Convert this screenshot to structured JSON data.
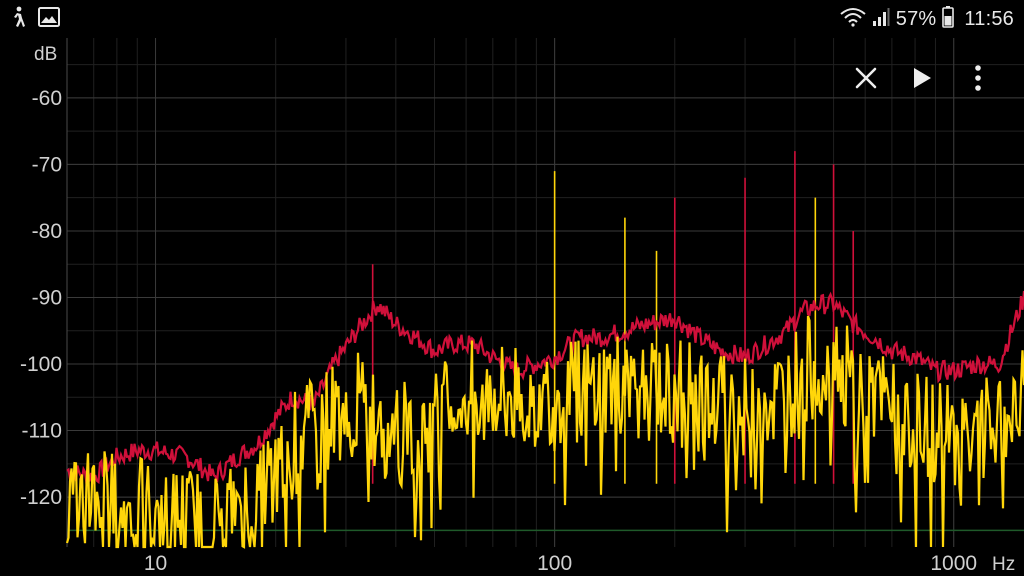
{
  "status_bar": {
    "left_icons": [
      "walking-icon",
      "image-icon"
    ],
    "right_icons": [
      "wifi-icon",
      "signal-icon",
      "battery-icon"
    ],
    "battery": "57%",
    "time": "11:56"
  },
  "toolbar": {
    "buttons": [
      {
        "icon": "close-icon"
      },
      {
        "icon": "play-icon"
      },
      {
        "icon": "more-vert-icon"
      }
    ]
  },
  "colors": {
    "background": "#000000",
    "grid_major": "#3a3a3a",
    "grid_minor": "#202020",
    "peak_trace": "#d0103a",
    "live_trace": "#ffd60a",
    "noise_floor_line": "#1f5a2a"
  },
  "chart_data": {
    "type": "line",
    "scale_x": "log",
    "ylabel": "dB",
    "xlim": [
      6,
      1500
    ],
    "ylim": [
      -127.5,
      -51
    ],
    "y_ticks": [
      -60,
      -70,
      -80,
      -90,
      -100,
      -110,
      -120
    ],
    "y_tick_labels": [
      "-60",
      "-70",
      "-80",
      "-90",
      "-100",
      "-110",
      "-120"
    ],
    "x_ticks": [
      10,
      100,
      1000
    ],
    "x_tick_labels": [
      "10",
      "100",
      "1000"
    ],
    "x_unit_label": "Hz",
    "grid": true,
    "noise_floor_db": -125,
    "series": [
      {
        "role": "peak-hold",
        "color": "#d0103a",
        "x": [
          6,
          7,
          8,
          9,
          10,
          12,
          14,
          16,
          18,
          20,
          22,
          25,
          28,
          32,
          36,
          40,
          45,
          50,
          56,
          63,
          70,
          80,
          90,
          100,
          115,
          130,
          150,
          170,
          200,
          230,
          260,
          300,
          340,
          380,
          420,
          460,
          500,
          560,
          630,
          700,
          800,
          900,
          1000,
          1150,
          1300,
          1500
        ],
        "y": [
          -116,
          -117,
          -114,
          -113,
          -113,
          -114,
          -117,
          -114,
          -112,
          -108,
          -105,
          -106,
          -100,
          -95,
          -91,
          -94,
          -96,
          -98,
          -97,
          -97,
          -99,
          -101,
          -100,
          -99,
          -96,
          -96,
          -95,
          -94,
          -93,
          -96,
          -98,
          -99,
          -97,
          -95,
          -92,
          -91,
          -91,
          -94,
          -96,
          -98,
          -99,
          -101,
          -101,
          -100,
          -100,
          -90
        ]
      },
      {
        "role": "live",
        "color": "#ffd60a",
        "x": [
          6,
          7,
          8,
          9,
          10,
          12,
          14,
          16,
          18,
          20,
          22,
          25,
          28,
          32,
          36,
          40,
          45,
          50,
          56,
          63,
          70,
          80,
          90,
          100,
          115,
          130,
          150,
          170,
          200,
          230,
          260,
          300,
          340,
          380,
          420,
          460,
          500,
          560,
          630,
          700,
          800,
          900,
          1000,
          1150,
          1300,
          1500
        ],
        "y": [
          -120,
          -119,
          -121,
          -122,
          -122,
          -123,
          -124,
          -121,
          -120,
          -116,
          -112,
          -110,
          -107,
          -106,
          -108,
          -110,
          -110,
          -109,
          -106,
          -104,
          -104,
          -105,
          -105,
          -104,
          -104,
          -103,
          -103,
          -104,
          -104,
          -105,
          -106,
          -107,
          -106,
          -104,
          -101,
          -100,
          -100,
          -103,
          -105,
          -107,
          -109,
          -110,
          -111,
          -110,
          -110,
          -104
        ]
      }
    ],
    "spikes": [
      {
        "x": 100,
        "y": -71,
        "color": "#ffd60a"
      },
      {
        "x": 150,
        "y": -78,
        "color": "#ffd60a"
      },
      {
        "x": 180,
        "y": -83,
        "color": "#ffd60a"
      },
      {
        "x": 200,
        "y": -75,
        "color": "#d0103a"
      },
      {
        "x": 300,
        "y": -72,
        "color": "#d0103a"
      },
      {
        "x": 400,
        "y": -68,
        "color": "#d0103a"
      },
      {
        "x": 450,
        "y": -75,
        "color": "#ffd60a"
      },
      {
        "x": 500,
        "y": -70,
        "color": "#d0103a"
      },
      {
        "x": 560,
        "y": -80,
        "color": "#d0103a"
      },
      {
        "x": 35,
        "y": -85,
        "color": "#d0103a"
      }
    ]
  }
}
